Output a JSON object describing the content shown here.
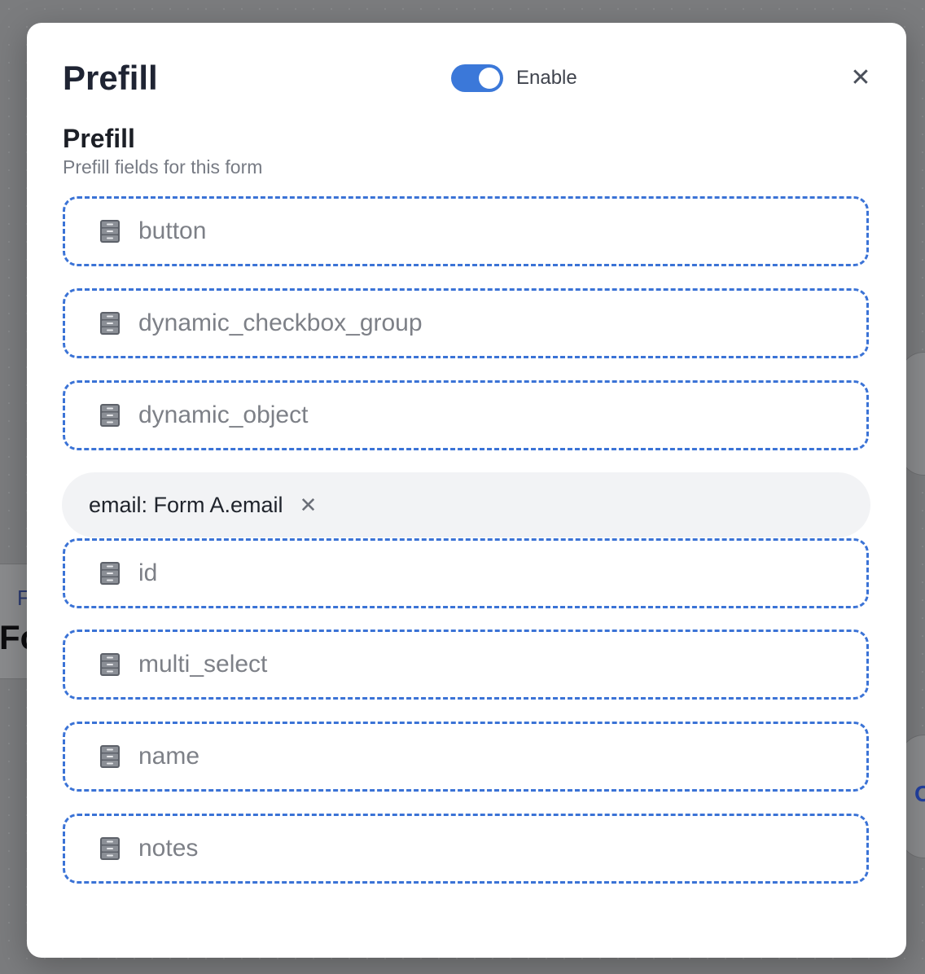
{
  "modal": {
    "title": "Prefill",
    "toggle": {
      "label": "Enable",
      "on": true
    },
    "close_glyph": "✕",
    "section": {
      "title": "Prefill",
      "subtitle": "Prefill fields for this form"
    },
    "fields_icon": "file-cabinet-icon",
    "fields": [
      {
        "label": "button"
      },
      {
        "label": "dynamic_checkbox_group"
      },
      {
        "label": "dynamic_object"
      },
      {
        "label": "id"
      },
      {
        "label": "multi_select"
      },
      {
        "label": "name"
      },
      {
        "label": "notes"
      }
    ],
    "mapping_chip": {
      "text": "email: Form A.email",
      "remove_glyph": "✕"
    }
  },
  "background": {
    "left_node": {
      "small": "F",
      "big": "Fo"
    },
    "right_marks": [
      "",
      "O"
    ]
  },
  "colors": {
    "accent": "#3b78d9",
    "dashed_border": "#3b73d6",
    "overlay": "#7b7c7e",
    "chip_bg": "#f2f3f5"
  }
}
